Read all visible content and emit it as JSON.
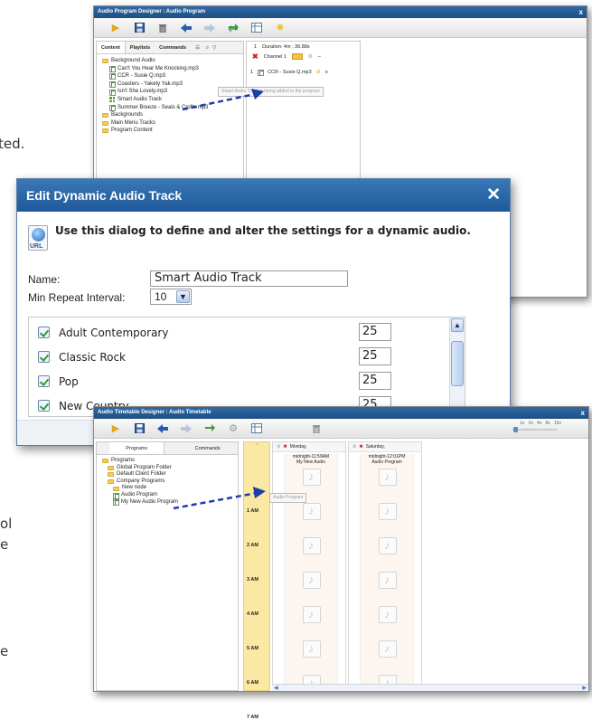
{
  "background_fragments": {
    "a": "ted.",
    "b": "ol",
    "c": "e",
    "d": "e"
  },
  "program_window": {
    "title": "Audio Program Designer : Audio Program",
    "close": "x",
    "tabs": [
      "Content",
      "Playlists",
      "Commands"
    ],
    "tree": [
      {
        "label": "Background Audio",
        "type": "folder",
        "indent": 0
      },
      {
        "label": "Can't You Hear Me Knocking.mp3",
        "type": "audio",
        "indent": 1
      },
      {
        "label": "CCR - Susie Q.mp3",
        "type": "audio",
        "indent": 1
      },
      {
        "label": "Coasters - Yakety Yak.mp3",
        "type": "audio",
        "indent": 1
      },
      {
        "label": "Isn't She Lovely.mp3",
        "type": "audio",
        "indent": 1
      },
      {
        "label": "Smart Audio Track",
        "type": "dynamic",
        "indent": 1
      },
      {
        "label": "Summer Breeze - Seals & Crofts.mp3",
        "type": "audio",
        "indent": 1
      },
      {
        "label": "Backgrounds",
        "type": "folder",
        "indent": 0
      },
      {
        "label": "Main Menu Tracks",
        "type": "folder",
        "indent": 0
      },
      {
        "label": "Program Content",
        "type": "folder",
        "indent": 0
      }
    ],
    "program": {
      "index": "1",
      "duration": "Duration: 4m : 36.88s",
      "channel": "Channel 1",
      "item_index": "1",
      "item": "CCR - Susie Q.mp3",
      "tooltip": "Smart Audio Track is being added to the program"
    }
  },
  "dialog": {
    "title": "Edit Dynamic Audio Track",
    "close": "✕",
    "icon_label": "URL",
    "description": "Use this dialog to define and alter the settings for a dynamic audio.",
    "name_label": "Name:",
    "name_value": "Smart Audio Track",
    "interval_label": "Min Repeat Interval:",
    "interval_value": "10",
    "categories": [
      {
        "label": "Adult Contemporary",
        "value": "25"
      },
      {
        "label": "Classic Rock",
        "value": "25"
      },
      {
        "label": "Pop",
        "value": "25"
      },
      {
        "label": "New Country",
        "value": "25"
      }
    ]
  },
  "timetable_window": {
    "title": "Audio Timetable Designer : Audio Timetable",
    "close": "x",
    "zoom": "1x   2x   4x   8x   16x",
    "tabs": [
      "Programs",
      "Commands"
    ],
    "tree": [
      {
        "label": "Programs",
        "type": "folder",
        "indent": 0
      },
      {
        "label": "Global Program Folder",
        "type": "folder",
        "indent": 1
      },
      {
        "label": "Default Client Folder",
        "type": "folder",
        "indent": 1
      },
      {
        "label": "Company Programs",
        "type": "folder",
        "indent": 1
      },
      {
        "label": "New node",
        "type": "folder",
        "indent": 2
      },
      {
        "label": "Audio Program",
        "type": "audio",
        "indent": 2
      },
      {
        "label": "My New Audio Program",
        "type": "audio",
        "indent": 2
      }
    ],
    "hours": [
      "1 AM",
      "2 AM",
      "3 AM",
      "4 AM",
      "5 AM",
      "6 AM",
      "7 AM"
    ],
    "days": [
      {
        "name": "Monday,",
        "time": "midnight-11:59AM",
        "program": "My New Audio"
      },
      {
        "name": "Saturday,",
        "time": "midnight-12:01PM",
        "program": "Audio Program"
      }
    ],
    "drag_label": "Audio Program"
  },
  "colors": {
    "title_blue": "#1f5898",
    "accent_yellow": "#fbe9a3",
    "arrow_blue": "#1a3fa8"
  }
}
